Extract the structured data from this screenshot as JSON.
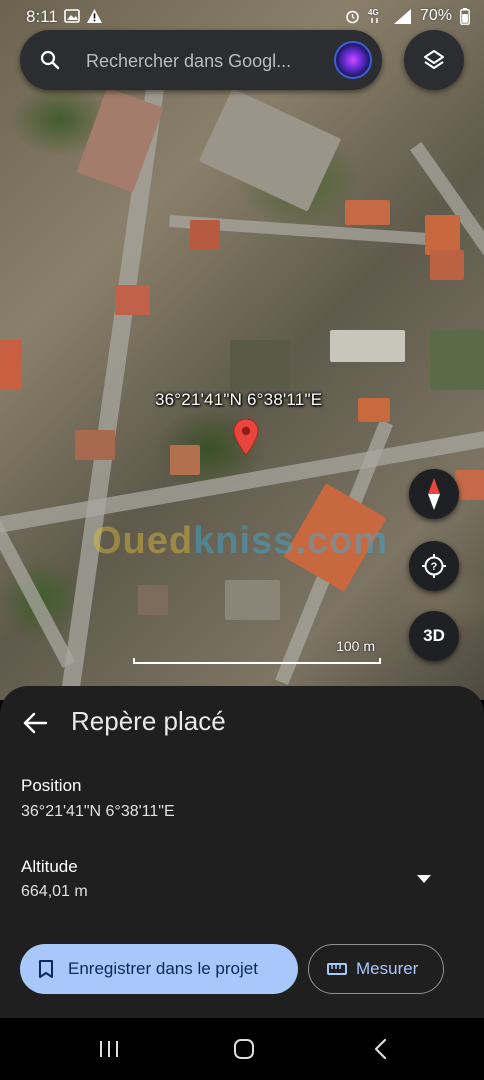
{
  "status_bar": {
    "time": "8:11",
    "left_icons": [
      "gallery-icon",
      "warning-icon"
    ],
    "right_icons": [
      "alarm-icon",
      "network-4g-icon",
      "signal-icon"
    ],
    "battery": "70%"
  },
  "search": {
    "placeholder": "Rechercher dans Googl..."
  },
  "map": {
    "coordinate_label": "36°21'41\"N 6°38'11\"E",
    "watermark_part1": "Oued",
    "watermark_part2": "kniss",
    "watermark_part3": ".com",
    "scale_label": "100 m",
    "view_3d_label": "3D"
  },
  "sheet": {
    "title": "Repère placé",
    "position_label": "Position",
    "position_value": "36°21'41\"N 6°38'11\"E",
    "altitude_label": "Altitude",
    "altitude_value": "664,01 m",
    "save_label": "Enregistrer dans le projet",
    "measure_label": "Mesurer"
  },
  "colors": {
    "accent": "#a8c7fa",
    "sheet_bg": "#1f1f20",
    "pin": "#e8453c"
  }
}
